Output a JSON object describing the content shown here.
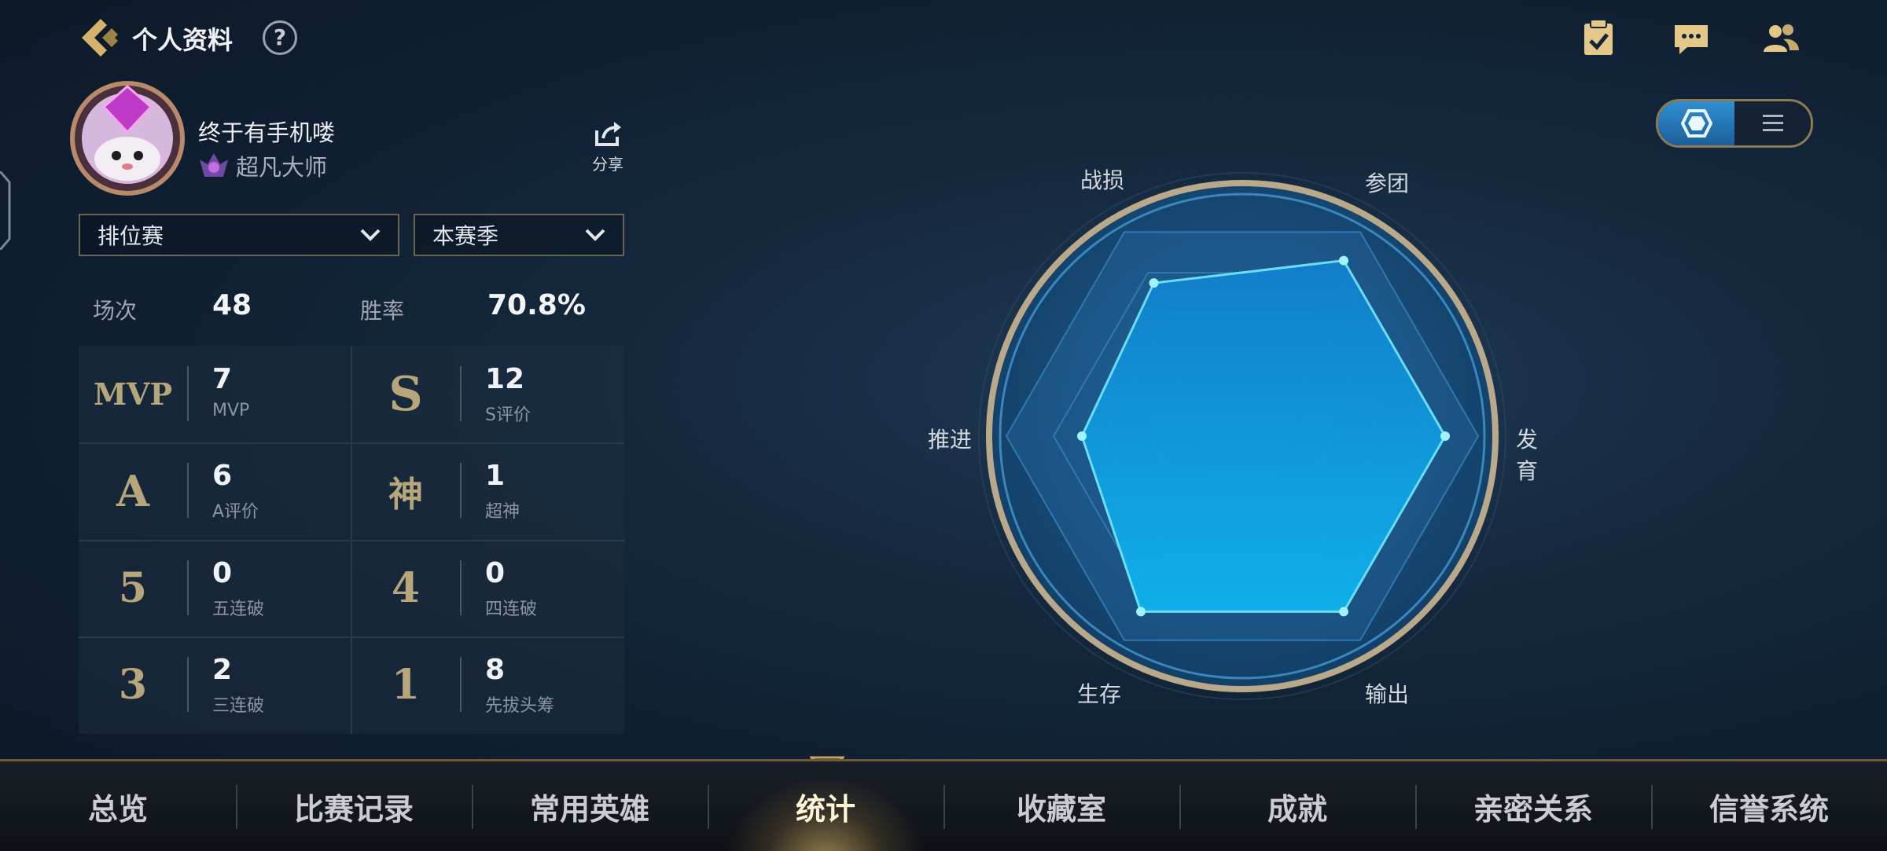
{
  "header": {
    "title": "个人资料",
    "help_label": "?"
  },
  "profile": {
    "name": "终于有手机喽",
    "rank": "超凡大师",
    "share_label": "分享"
  },
  "filters": {
    "mode": "排位赛",
    "season": "本赛季"
  },
  "summary": {
    "games_label": "场次",
    "games_value": "48",
    "winrate_label": "胜率",
    "winrate_value": "70.8%"
  },
  "stats": [
    {
      "icon": "MVP",
      "value": "7",
      "desc": "MVP"
    },
    {
      "icon": "S",
      "value": "12",
      "desc": "S评价"
    },
    {
      "icon": "A",
      "value": "6",
      "desc": "A评价"
    },
    {
      "icon": "神",
      "value": "1",
      "desc": "超神"
    },
    {
      "icon": "5",
      "value": "0",
      "desc": "五连破"
    },
    {
      "icon": "4",
      "value": "0",
      "desc": "四连破"
    },
    {
      "icon": "3",
      "value": "2",
      "desc": "三连破"
    },
    {
      "icon": "1",
      "value": "8",
      "desc": "先拔头筹"
    }
  ],
  "radar": {
    "labels": [
      "战损",
      "参团",
      "发育",
      "输出",
      "生存",
      "推进"
    ],
    "values": [
      0.75,
      0.86,
      0.86,
      0.86,
      0.86,
      0.68
    ]
  },
  "nav": {
    "tabs": [
      "总览",
      "比赛记录",
      "常用英雄",
      "统计",
      "收藏室",
      "成就",
      "亲密关系",
      "信誉系统"
    ],
    "active": "统计"
  },
  "colors": {
    "accent": "#c6a460",
    "radar_fill": "#14a3e6",
    "radar_stroke": "#6ee6ff"
  }
}
